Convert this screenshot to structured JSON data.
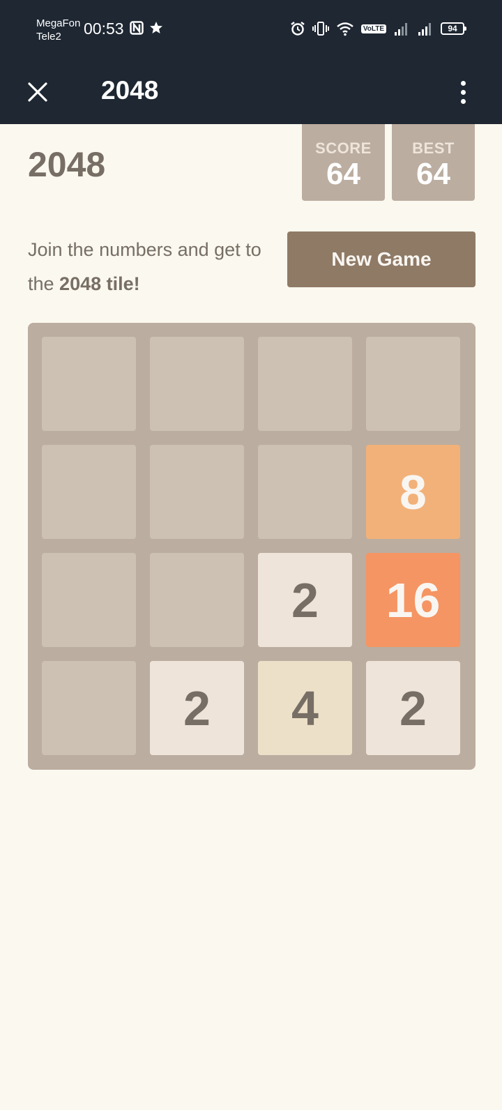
{
  "status_bar": {
    "carrier_1": "MegaFon",
    "carrier_2": "Tele2",
    "time": "00:53",
    "volte": "VoLTE",
    "battery": "94"
  },
  "app_bar": {
    "title": "2048",
    "icons": [
      "close-icon",
      "more-vertical-icon"
    ]
  },
  "game": {
    "title": "2048",
    "score_label": "SCORE",
    "score_value": "64",
    "best_label": "BEST",
    "best_value": "64",
    "intro_part1": "Join the numbers and get to the ",
    "intro_bold": "2048 tile!",
    "new_game_label": "New Game"
  },
  "board": {
    "size": 4,
    "cells": [
      [
        null,
        null,
        null,
        null
      ],
      [
        null,
        null,
        null,
        8
      ],
      [
        null,
        null,
        2,
        16
      ],
      [
        null,
        2,
        4,
        2
      ]
    ]
  },
  "colors": {
    "background": "#faf8ef",
    "board": "#bbada0",
    "empty_cell": "#cdc1b4",
    "tile_2": "#eee4da",
    "tile_4": "#ede0c8",
    "tile_8": "#f2b179",
    "tile_16": "#f59563",
    "dark_text": "#776e65",
    "light_text": "#f9f6f2",
    "button": "#8f7a66",
    "header_bar": "#1e2732"
  }
}
